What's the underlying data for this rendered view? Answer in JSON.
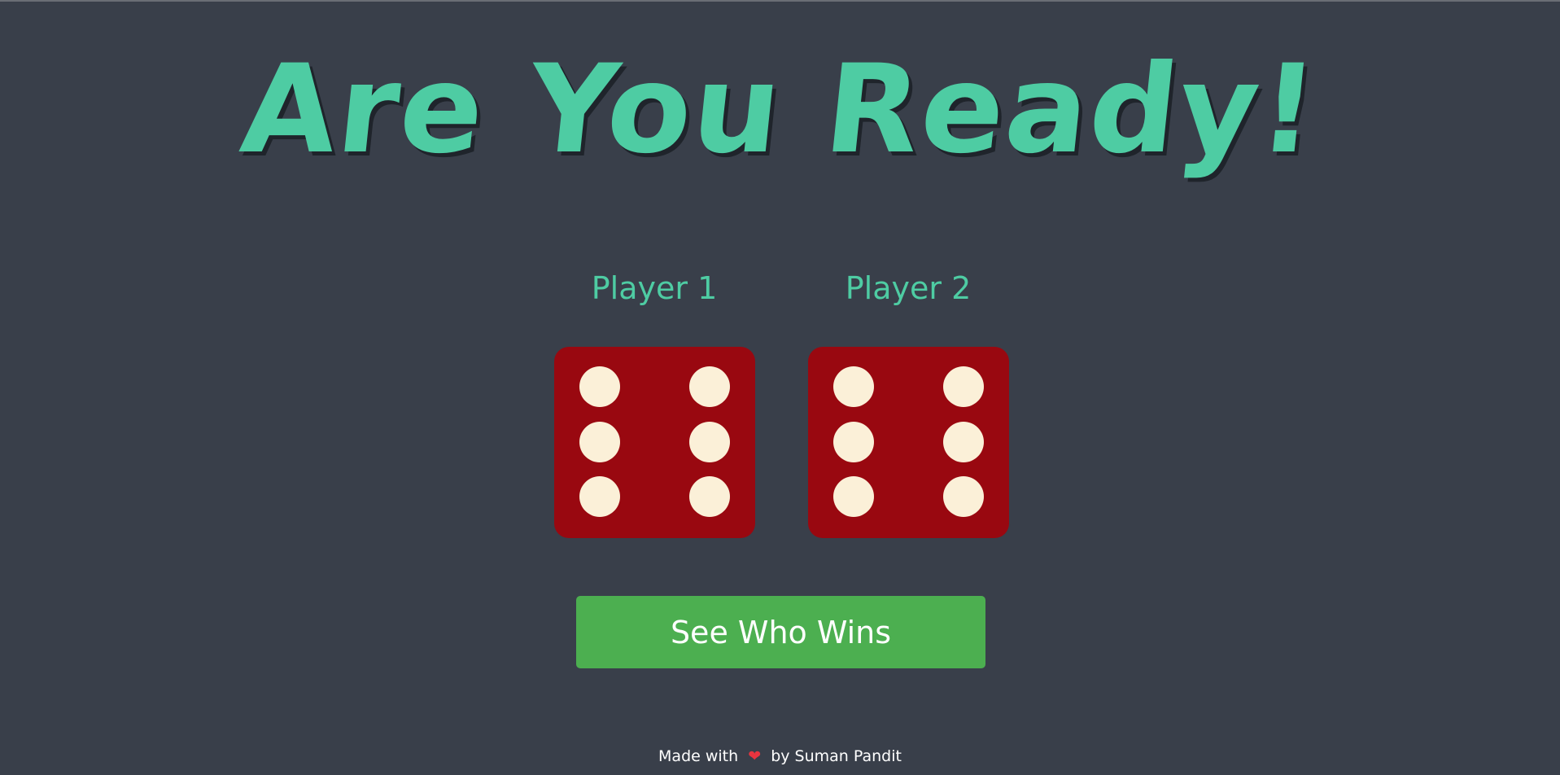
{
  "title": "Are You Ready!",
  "players": [
    {
      "label": "Player 1",
      "die_value": 6
    },
    {
      "label": "Player 2",
      "die_value": 6
    }
  ],
  "button": {
    "label": "See Who Wins"
  },
  "footer": {
    "prefix": "Made with",
    "heart_icon": "heart-icon",
    "suffix": "by Suman Pandit"
  },
  "colors": {
    "background": "#393f4a",
    "accent": "#4ecca3",
    "die": "#990810",
    "pip": "#fbf0d8",
    "button": "#4caf50"
  }
}
